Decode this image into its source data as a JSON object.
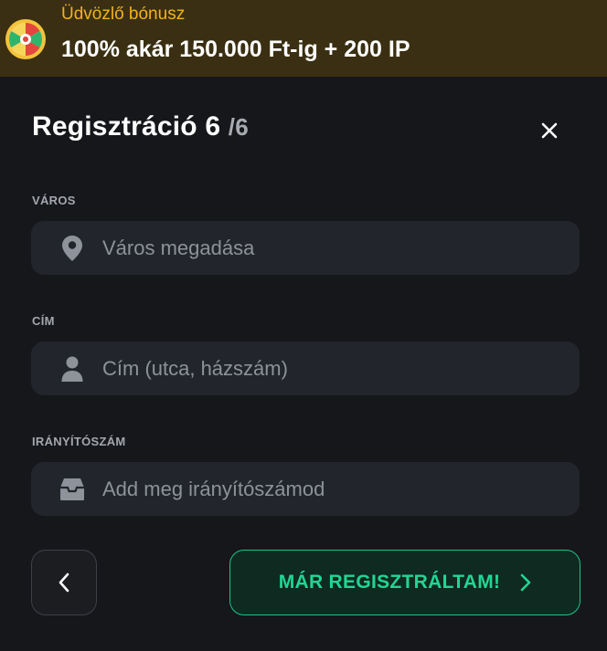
{
  "bonus": {
    "title": "Üdvözlő bónusz",
    "offer": "100% akár 150.000 Ft-ig + 200 IP",
    "icon": "prize-wheel-icon"
  },
  "form": {
    "title": "Regisztráció 6",
    "step_total": "/6",
    "close_icon": "close-icon",
    "fields": [
      {
        "label": "VÁROS",
        "placeholder": "Város megadása",
        "value": "",
        "icon": "map-pin-icon"
      },
      {
        "label": "CÍM",
        "placeholder": "Cím (utca, házszám)",
        "value": "",
        "icon": "person-icon"
      },
      {
        "label": "IRÁNYÍTÓSZÁM",
        "placeholder": "Add meg irányítószámod",
        "value": "",
        "icon": "inbox-icon"
      }
    ],
    "back_icon": "chevron-left-icon",
    "submit_label": "MÁR REGISZTRÁLTAM!",
    "submit_icon": "chevron-right-icon"
  },
  "colors": {
    "accent": "#21d694",
    "bonus_title": "#f2b21c",
    "bonus_bg": "#3a2f12",
    "panel_bg": "#16171a",
    "field_bg": "#22252b"
  }
}
